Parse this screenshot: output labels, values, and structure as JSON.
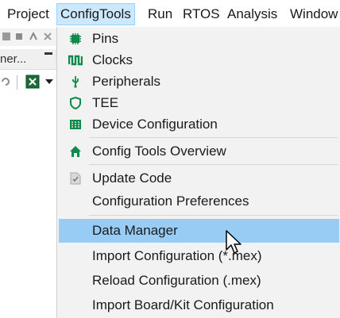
{
  "menubar": {
    "items": [
      {
        "label": "Project"
      },
      {
        "label": "ConfigTools"
      },
      {
        "label": "Run"
      },
      {
        "label": "RTOS"
      },
      {
        "label": "Analysis"
      },
      {
        "label": "Window"
      }
    ]
  },
  "background": {
    "panel_title": "ner..."
  },
  "menu": {
    "items": [
      {
        "label": "Pins",
        "icon": "pins-icon"
      },
      {
        "label": "Clocks",
        "icon": "clocks-icon"
      },
      {
        "label": "Peripherals",
        "icon": "peripherals-icon"
      },
      {
        "label": "TEE",
        "icon": "tee-shield-icon"
      },
      {
        "label": "Device Configuration",
        "icon": "device-configuration-icon"
      },
      {
        "label": "Config Tools Overview",
        "icon": "home-icon"
      },
      {
        "label": "Update Code",
        "icon": "update-code-icon"
      },
      {
        "label": "Configuration Preferences",
        "icon": ""
      },
      {
        "label": "Data Manager",
        "icon": ""
      },
      {
        "label": "Import Configuration (*.mex)",
        "icon": ""
      },
      {
        "label": "Reload Configuration (.mex)",
        "icon": ""
      },
      {
        "label": "Import Board/Kit Configuration",
        "icon": ""
      }
    ]
  },
  "colors": {
    "icon_green": "#0f8a4a",
    "highlight": "#99ccf5",
    "active_menu": "#cce8ff"
  }
}
